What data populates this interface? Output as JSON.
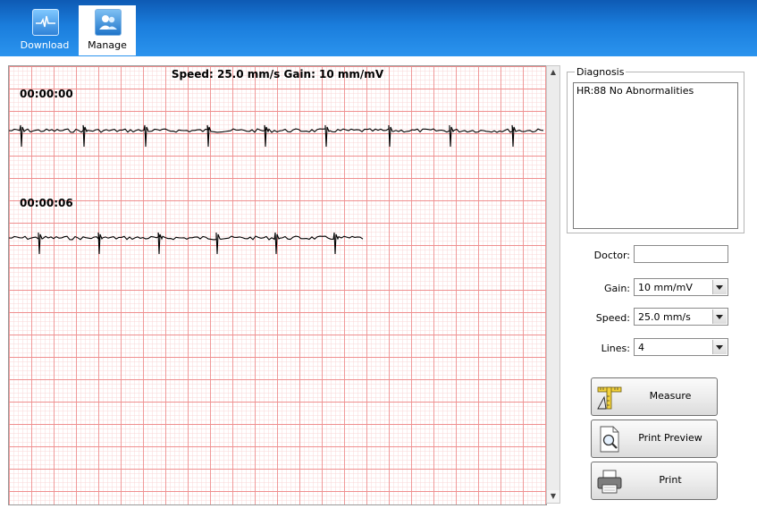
{
  "tabs": [
    {
      "label": "Download",
      "icon": "ecg-wave-icon",
      "active": false
    },
    {
      "label": "Manage",
      "icon": "users-icon",
      "active": true
    }
  ],
  "ecg": {
    "header": "Speed: 25.0 mm/s  Gain: 10 mm/mV",
    "strips": [
      {
        "timestamp": "00:00:00"
      },
      {
        "timestamp": "00:00:06"
      }
    ],
    "grid_minor_color": "#f8d7d7",
    "grid_major_color": "#ef8f8f",
    "trace_color": "#000000"
  },
  "scrollbar": {
    "up": "▲",
    "down": "▼"
  },
  "diagnosis": {
    "legend": "Diagnosis",
    "text": "HR:88  No Abnormalities"
  },
  "fields": {
    "doctor": {
      "label": "Doctor:",
      "value": ""
    },
    "gain": {
      "label": "Gain:",
      "value": "10 mm/mV"
    },
    "speed": {
      "label": "Speed:",
      "value": "25.0 mm/s"
    },
    "lines": {
      "label": "Lines:",
      "value": "4"
    }
  },
  "buttons": {
    "measure": "Measure",
    "print_preview": "Print Preview",
    "print": "Print"
  }
}
